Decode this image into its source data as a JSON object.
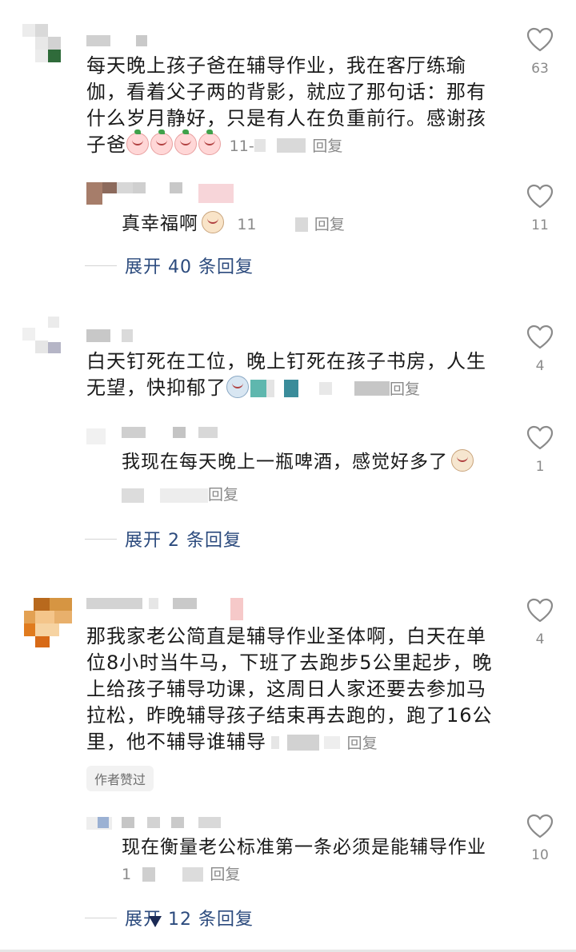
{
  "comments": [
    {
      "text": "每天晚上孩子爸在辅导作业，我在客厅练瑜伽，看着父子两的背影，就应了那句话：那有什么岁月静好，只是有人在负重前行。感谢孩子爸",
      "date_partial": "11-",
      "reply_label": "回复",
      "likes": "63",
      "reply": {
        "text": "真幸福啊",
        "date_partial": "11",
        "reply_label": "回复",
        "likes": "11"
      },
      "expand_label": "展开 40 条回复"
    },
    {
      "text": "白天钉死在工位，晚上钉死在孩子书房，人生无望，快抑郁了",
      "reply_label": "回复",
      "likes": "4",
      "reply": {
        "text": "我现在每天晚上一瓶啤酒，感觉好多了",
        "reply_label": "回复",
        "likes": "1"
      },
      "expand_label": "展开 2 条回复"
    },
    {
      "text": "那我家老公简直是辅导作业圣体啊，白天在单位8小时当牛马，下班了去跑步5公里起步，晚上给孩子辅导功课，这周日人家还要去参加马拉松，昨晚辅导孩子结束再去跑的，跑了16公里，他不辅导谁辅导",
      "reply_label": "回复",
      "likes": "4",
      "badge": "作者赞过",
      "reply": {
        "text": "现在衡量老公标准第一条必须是能辅导作业",
        "date_partial": "1",
        "reply_label": "回复",
        "likes": "10"
      },
      "expand_label": "展开 12 条回复"
    }
  ],
  "icons": {
    "like": "heart-outline-icon",
    "emoji": "blush-face-emoji-icon"
  },
  "colors": {
    "link": "#2b4a7d",
    "meta": "#8a8a8a",
    "text": "#1a1a1a"
  }
}
